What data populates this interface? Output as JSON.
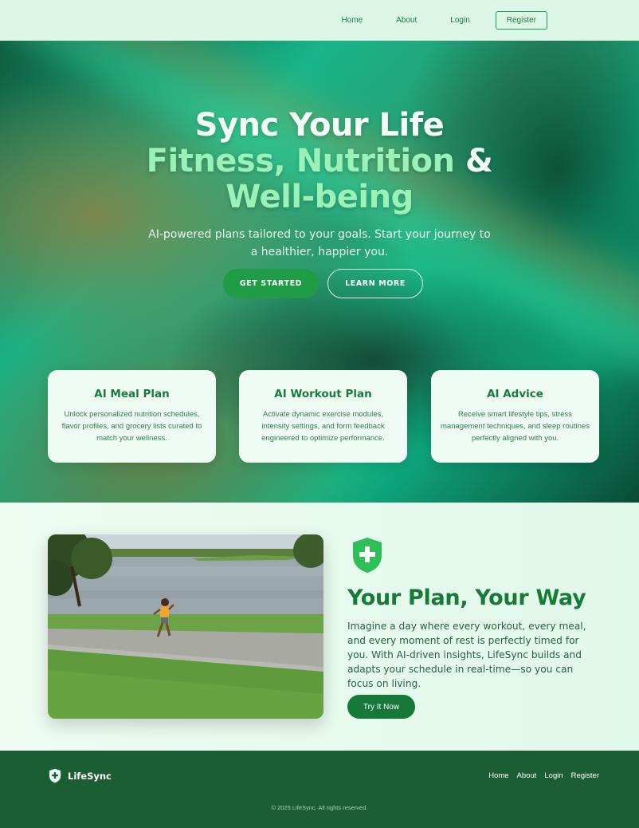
{
  "nav": {
    "items": [
      {
        "label": "Home"
      },
      {
        "label": "About"
      },
      {
        "label": "Login"
      },
      {
        "label": "Register"
      }
    ]
  },
  "hero": {
    "title_line1": "Sync Your Life",
    "title_line2_part1": "Fitness,",
    "title_line2_part2": "Nutrition",
    "title_line2_amp": "&",
    "title_line3": "Well-being",
    "subtitle": "AI-powered plans tailored to your goals. Start your journey to a healthier, happier you.",
    "primary_button": "GET STARTED",
    "secondary_button": "LEARN MORE"
  },
  "cards": [
    {
      "title": "AI Meal Plan",
      "text": "Unlock personalized nutrition schedules, flavor profiles, and grocery lists curated to match your wellness."
    },
    {
      "title": "AI Workout Plan",
      "text": "Activate dynamic exercise modules, intensity settings, and form feedback engineered to optimize performance."
    },
    {
      "title": "AI Advice",
      "text": "Receive smart lifestyle tips, stress management techniques, and sleep routines perfectly aligned with you."
    }
  ],
  "feature": {
    "icon": "shield-plus-icon",
    "heading": "Your Plan, Your Way",
    "body": "Imagine a day where every workout, every meal, and every moment of rest is perfectly timed for you. With AI-driven insights, LifeSync builds and adapts your schedule in real-time—so you can focus on living.",
    "button": "Try It Now"
  },
  "footer": {
    "brand": "LifeSync",
    "links": [
      {
        "label": "Home"
      },
      {
        "label": "About"
      },
      {
        "label": "Login"
      },
      {
        "label": "Register"
      }
    ],
    "copyright": "© 2025 LifeSync. All rights reserved."
  },
  "colors": {
    "primary": "#1f9c45",
    "dark_green": "#1b5e34",
    "accent_text": "#9af2b8"
  }
}
